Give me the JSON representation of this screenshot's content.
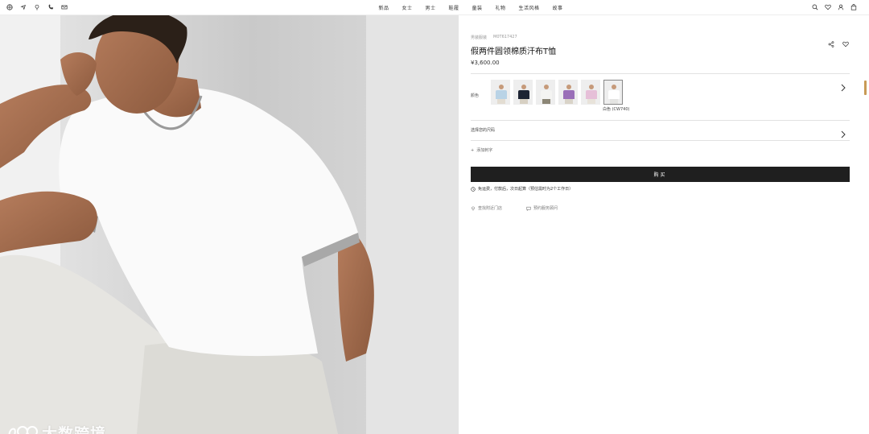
{
  "nav": {
    "items": [
      "新品",
      "女士",
      "男士",
      "鞋履",
      "童装",
      "礼物",
      "生活风格",
      "故事"
    ],
    "left_icons": [
      "globe-icon",
      "location-icon",
      "pin-icon",
      "phone-icon",
      "mail-icon"
    ],
    "right_icons": [
      "search-icon",
      "heart-icon",
      "user-icon",
      "bag-icon"
    ]
  },
  "watermark": {
    "text": "大数跨境"
  },
  "product": {
    "crumb_category": "男装服装",
    "crumb_code": "M0T617427",
    "title": "假两件圆领棉质汗布T恤",
    "price": "¥3,600.00",
    "color_label": "颜色",
    "selected_color": "白色 (CW740)",
    "swatches": [
      {
        "shirt": "#b9d3e6",
        "legs": "#e3ddd2"
      },
      {
        "shirt": "#1d2433",
        "legs": "#d7d0c3"
      },
      {
        "shirt": "#f4f4f2",
        "legs": "#8c8676"
      },
      {
        "shirt": "#9a6fb8",
        "legs": "#d9d3c8"
      },
      {
        "shirt": "#e6bfd8",
        "legs": "#e8e3da"
      },
      {
        "shirt": "#ffffff",
        "legs": "#e4e4e2",
        "selected": true
      }
    ],
    "size_label": "选择您的尺码",
    "add_label": "添加刺字",
    "buy_label": "购买",
    "shipping_text": "免运费，付款后，次日起算（预估需时为2个工作日）",
    "store_label": "查找附近门店",
    "advisor_label": "预约服务顾问"
  },
  "colors": {
    "button": "#1f1f1f",
    "accent": "#c89a55"
  }
}
